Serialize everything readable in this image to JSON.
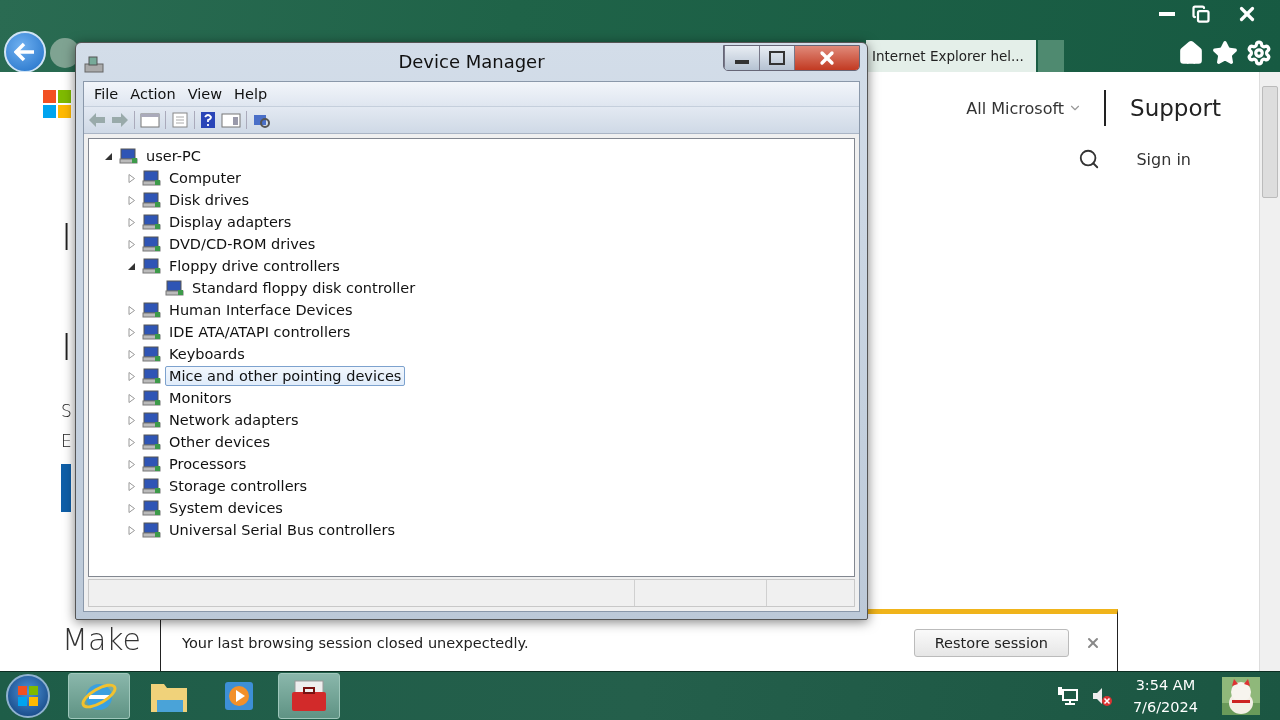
{
  "browser": {
    "tab": {
      "title": "Internet Explorer hel..."
    }
  },
  "page": {
    "nav_menu": "All Microsoft",
    "brand": "Support",
    "sign_in": "Sign in",
    "partial_texts": [
      {
        "kind": "heading",
        "text": "I"
      },
      {
        "kind": "heading",
        "text": "I"
      },
      {
        "kind": "body",
        "text": "S"
      },
      {
        "kind": "body",
        "text": "E"
      }
    ],
    "footer_heading": "Make"
  },
  "notification": {
    "message": "Your last browsing session closed unexpectedly.",
    "button": "Restore session"
  },
  "device_manager": {
    "title": "Device Manager",
    "menu": [
      "File",
      "Action",
      "View",
      "Help"
    ],
    "tree": {
      "label": "user-PC",
      "expanded": true,
      "selected": false,
      "children": [
        {
          "label": "Computer",
          "expanded": false,
          "selected": false
        },
        {
          "label": "Disk drives",
          "expanded": false,
          "selected": false
        },
        {
          "label": "Display adapters",
          "expanded": false,
          "selected": false
        },
        {
          "label": "DVD/CD-ROM drives",
          "expanded": false,
          "selected": false
        },
        {
          "label": "Floppy drive controllers",
          "expanded": true,
          "selected": false,
          "children": [
            {
              "label": "Standard floppy disk controller",
              "selected": false
            }
          ]
        },
        {
          "label": "Human Interface Devices",
          "expanded": false,
          "selected": false
        },
        {
          "label": "IDE ATA/ATAPI controllers",
          "expanded": false,
          "selected": false
        },
        {
          "label": "Keyboards",
          "expanded": false,
          "selected": false
        },
        {
          "label": "Mice and other pointing devices",
          "expanded": false,
          "selected": true
        },
        {
          "label": "Monitors",
          "expanded": false,
          "selected": false
        },
        {
          "label": "Network adapters",
          "expanded": false,
          "selected": false
        },
        {
          "label": "Other devices",
          "expanded": false,
          "selected": false
        },
        {
          "label": "Processors",
          "expanded": false,
          "selected": false
        },
        {
          "label": "Storage controllers",
          "expanded": false,
          "selected": false
        },
        {
          "label": "System devices",
          "expanded": false,
          "selected": false
        },
        {
          "label": "Universal Serial Bus controllers",
          "expanded": false,
          "selected": false
        }
      ]
    }
  },
  "taskbar": {
    "apps": [
      {
        "kind": "ie",
        "active": true
      },
      {
        "kind": "folder",
        "active": false
      },
      {
        "kind": "media",
        "active": false
      },
      {
        "kind": "toolbox",
        "active": true
      }
    ],
    "time": "3:54 AM",
    "date": "7/6/2024"
  }
}
